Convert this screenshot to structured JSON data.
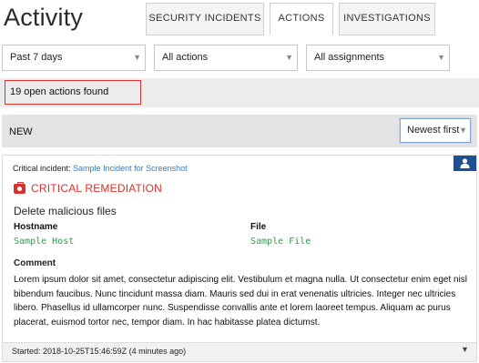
{
  "page": {
    "title": "Activity"
  },
  "tabs": [
    {
      "label": "SECURITY INCIDENTS"
    },
    {
      "label": "ACTIONS"
    },
    {
      "label": "INVESTIGATIONS"
    }
  ],
  "active_tab": "ACTIONS",
  "filters": {
    "time": "Past 7 days",
    "actions": "All actions",
    "assignments": "All assignments"
  },
  "results": {
    "count_text": "19 open actions found"
  },
  "group": {
    "label": "NEW",
    "sort": "Newest first"
  },
  "card": {
    "incident_prefix": "Critical incident:",
    "incident_link": "Sample Incident for Screenshot",
    "severity": "CRITICAL REMEDIATION",
    "action": "Delete malicious files",
    "hostname_label": "Hostname",
    "hostname_value": "Sample Host",
    "file_label": "File",
    "file_value": "Sample File",
    "comment_label": "Comment",
    "comment_text": "Lorem ipsum dolor sit amet, consectetur adipiscing elit. Vestibulum et magna nulla. Ut consectetur enim eget nisl bibendum faucibus. Nunc tincidunt massa diam. Mauris sed dui in erat venenatis ultricies. Integer nec ultricies libero. Phasellus id ullamcorper nunc. Suspendisse convallis ante et lorem laoreet tempus. Aliquam ac purus placerat, euismod tortor nec, tempor diam. In hac habitasse platea dictumst.",
    "started": "Started: 2018-10-25T15:46:59Z (4 minutes ago)"
  },
  "colors": {
    "critical": "#d9312b",
    "link": "#2c7bd6",
    "mono_value": "#2f9e4f",
    "assign_button": "#1d4f91",
    "highlight_border": "#e0332f"
  },
  "icons": {
    "severity": "medkit-icon",
    "assign": "person-icon",
    "dropdown": "caret-down-icon"
  }
}
